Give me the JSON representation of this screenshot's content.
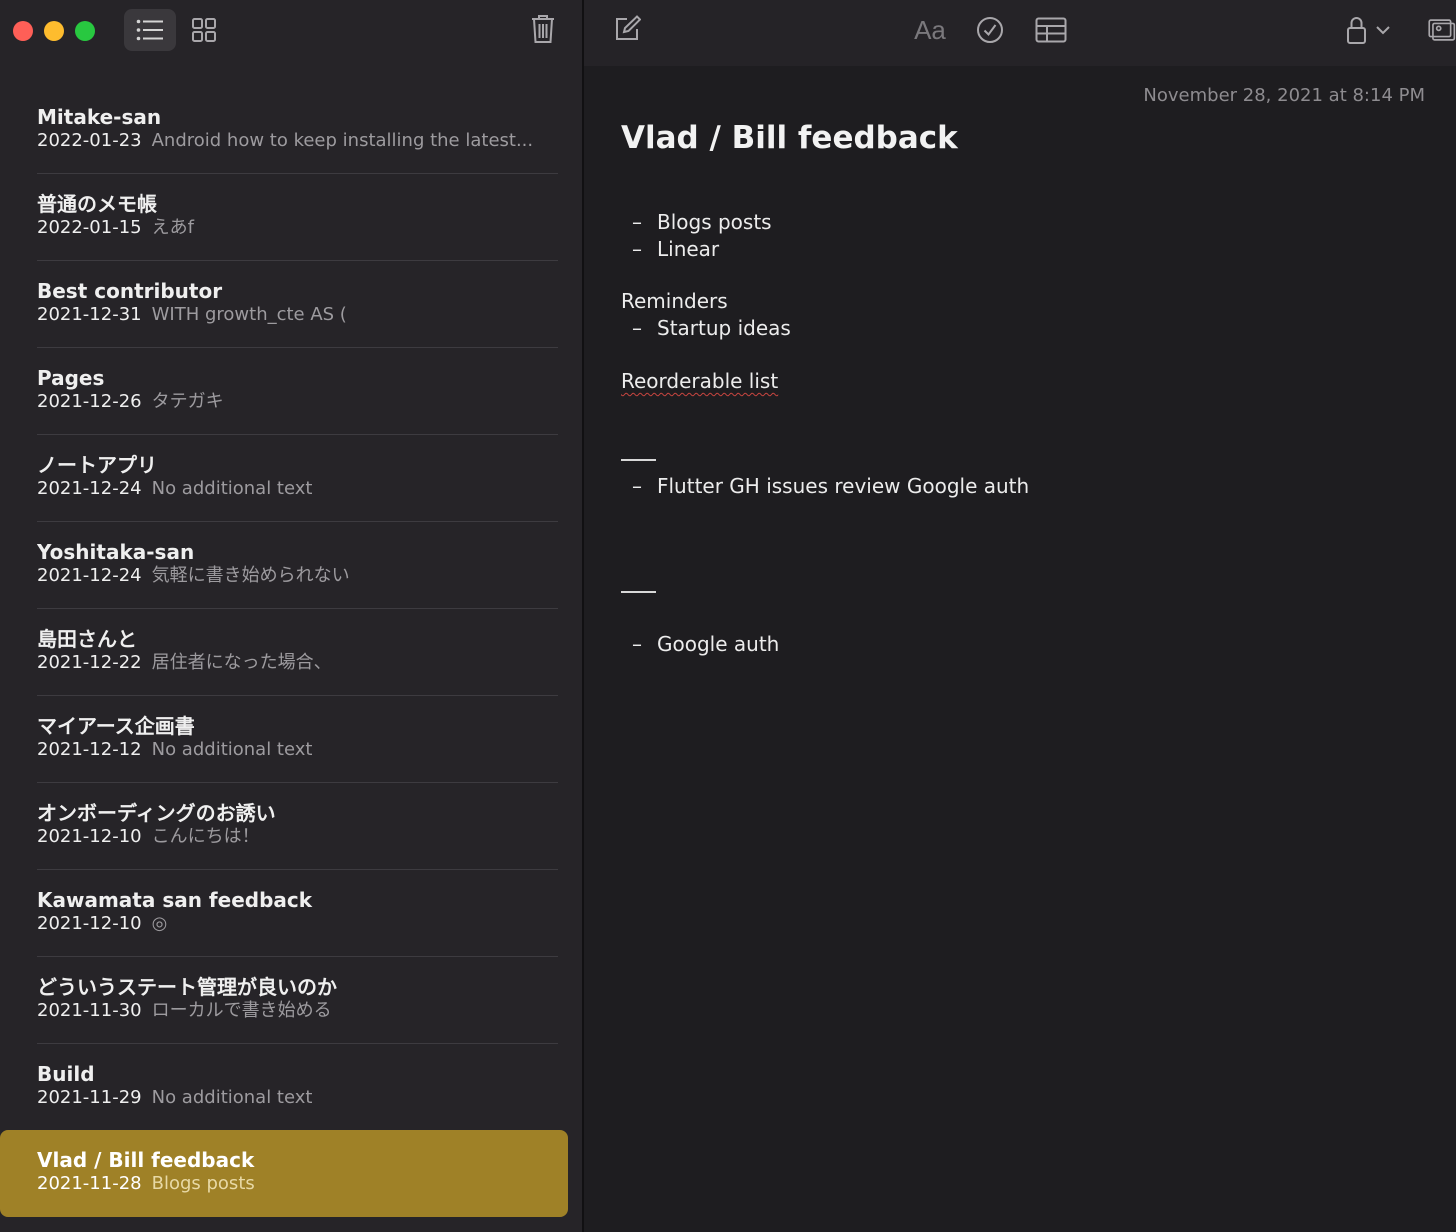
{
  "sidebar": {
    "notes": [
      {
        "title": "Mitake-san",
        "date": "2022-01-23",
        "snippet": "Android how to keep installing the latest..."
      },
      {
        "title": "普通のメモ帳",
        "date": "2022-01-15",
        "snippet": "えあf"
      },
      {
        "title": "Best contributor",
        "date": "2021-12-31",
        "snippet": "WITH growth_cte AS ("
      },
      {
        "title": "Pages",
        "date": "2021-12-26",
        "snippet": "タテガキ"
      },
      {
        "title": "ノートアプリ",
        "date": "2021-12-24",
        "snippet": "No additional text"
      },
      {
        "title": "Yoshitaka-san",
        "date": "2021-12-24",
        "snippet": "気軽に書き始められない"
      },
      {
        "title": "島田さんと",
        "date": "2021-12-22",
        "snippet": "居住者になった場合、"
      },
      {
        "title": "マイアース企画書",
        "date": "2021-12-12",
        "snippet": "No additional text"
      },
      {
        "title": "オンボーディングのお誘い",
        "date": "2021-12-10",
        "snippet": "こんにちは！"
      },
      {
        "title": "Kawamata san feedback",
        "date": "2021-12-10",
        "snippet": "◎"
      },
      {
        "title": "どういうステート管理が良いのか",
        "date": "2021-11-30",
        "snippet": "ローカルで書き始める"
      },
      {
        "title": "Build",
        "date": "2021-11-29",
        "snippet": "No additional text"
      }
    ],
    "selected": {
      "title": "Vlad / Bill feedback",
      "date": "2021-11-28",
      "snippet": "Blogs posts"
    }
  },
  "toolbar": {
    "format_label": "Aa",
    "icons": [
      "compose-icon",
      "format-icon",
      "checklist-icon",
      "table-icon",
      "lock-icon",
      "media-icon"
    ]
  },
  "editor": {
    "timestamp": "November 28, 2021 at 8:14 PM",
    "heading": "Vlad / Bill feedback",
    "dash": "–",
    "bullet_1": "Blogs posts",
    "bullet_2": "Linear",
    "reminders_label": "Reminders",
    "bullet_3": "Startup ideas",
    "reorderable": "Reorderable list",
    "bullet_4": "Flutter GH issues review Google auth",
    "bullet_5": "Google auth"
  },
  "colors": {
    "selected_bg": "#9f8127",
    "sidebar_bg": "#262428",
    "editor_bg": "#1e1d20",
    "close": "#fe5f57",
    "minimize": "#febc2e",
    "zoom": "#28c840"
  }
}
